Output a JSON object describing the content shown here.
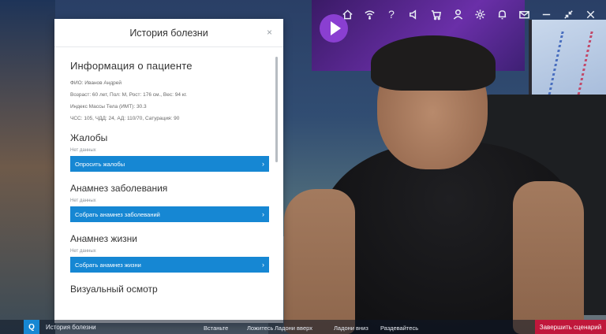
{
  "toolbar": {
    "icons": [
      "home-icon",
      "wifi-icon",
      "help-icon",
      "sound-icon",
      "cart-icon",
      "user-icon",
      "settings-icon",
      "bell-icon",
      "mail-icon",
      "minimize-icon",
      "restore-icon",
      "close-icon"
    ],
    "help_glyph": "?"
  },
  "modal": {
    "title": "История болезни",
    "close_glyph": "×",
    "patient_info": {
      "heading": "Информация о пациенте",
      "fio": "ФИО: Иванов Андрей",
      "params": "Возраст: 60 лет, Пол: М, Рост: 176 см., Вес: 94 кг.",
      "bmi": "Индекс Массы Тела (ИМТ): 30.3",
      "vitals": "ЧСС: 105, ЧДД: 24, АД: 110/70, Сатурация: 90"
    },
    "sections": [
      {
        "heading": "Жалобы",
        "status": "Нет данных",
        "action": "Опросить жалобы"
      },
      {
        "heading": "Анамнез заболевания",
        "status": "Нет данных",
        "action": "Собрать анамнез заболеваний"
      },
      {
        "heading": "Анамнез жизни",
        "status": "Нет данных",
        "action": "Собрать анамнез жизни"
      }
    ],
    "last_heading": "Визуальный осмотр",
    "chevron": "›"
  },
  "bottombar": {
    "q_label": "Q",
    "history_label": "История болезни",
    "poses": [
      "Встаньте",
      "Ложитесь",
      "Ладони вверх",
      "Ладони вниз",
      "Раздевайтесь"
    ],
    "finish_label": "Завершить сценарий"
  },
  "colors": {
    "accent": "#1687d3",
    "finish": "#c0173b",
    "text": "#333333"
  }
}
